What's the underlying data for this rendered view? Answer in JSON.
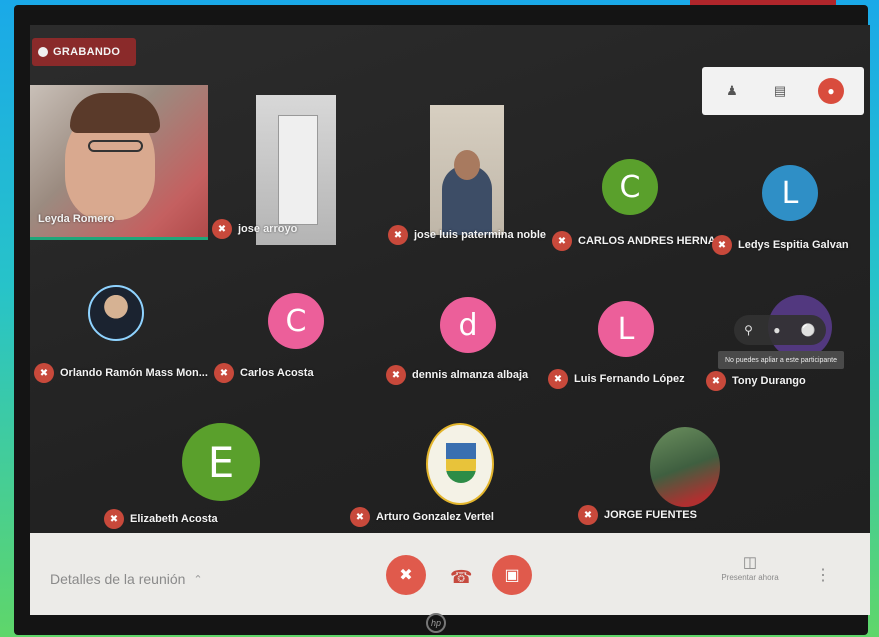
{
  "recording": {
    "label": "GRABANDO"
  },
  "top_controls": {
    "icons": [
      "people-icon",
      "chat-icon",
      "user-avatar-icon"
    ]
  },
  "participants": [
    {
      "name": "Leyda Romero"
    },
    {
      "name": "jose arroyo"
    },
    {
      "name": "jose luis patermina noble"
    },
    {
      "name": "CARLOS ANDRES HERNA...",
      "initial": "C"
    },
    {
      "name": "Ledys Espitia Galvan",
      "initial": "L"
    },
    {
      "name": "Orlando Ramón Mass Mon..."
    },
    {
      "name": "Carlos Acosta",
      "initial": "C"
    },
    {
      "name": "dennis almanza albaja",
      "initial": "d"
    },
    {
      "name": "Luis Fernando López",
      "initial": "L"
    },
    {
      "name": "Tony Durango"
    },
    {
      "name": "Elizabeth Acosta",
      "initial": "E"
    },
    {
      "name": "Arturo Gonzalez Vertel"
    },
    {
      "name": "JORGE FUENTES"
    }
  ],
  "hover_tooltip": "No puedes apliar a este participante",
  "bottom_bar": {
    "meeting_details": "Detalles de la reunión",
    "present_label": "Presentar ahora"
  },
  "colors": {
    "recording_bg": "#8a2a2a",
    "mic_off": "#c8493b",
    "control_red": "#e05a4c",
    "avatar_green": "#5aa02c",
    "avatar_blue": "#2f8fc6",
    "avatar_pink": "#ec5f9a"
  }
}
